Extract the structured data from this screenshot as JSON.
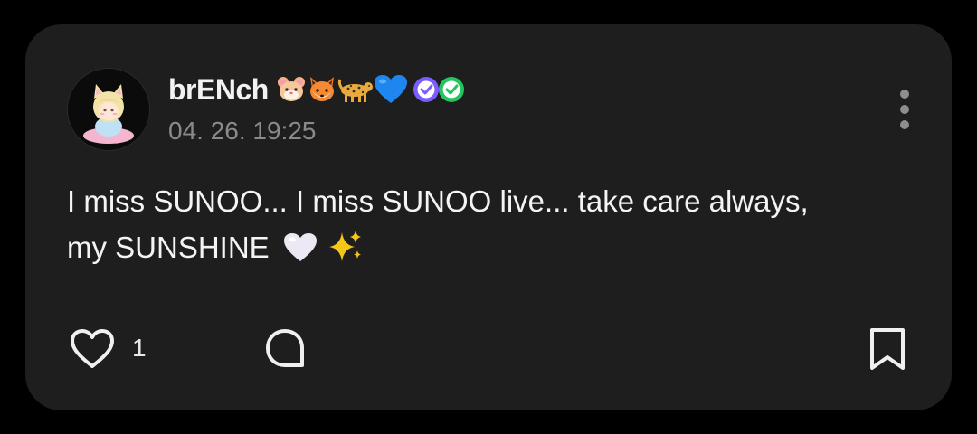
{
  "post": {
    "username": "brENch",
    "name_emojis": [
      "hamster-face-icon",
      "fox-face-icon",
      "leopard-icon",
      "blue-heart-icon"
    ],
    "badges": [
      "purple-verified-check-icon",
      "green-verified-check-icon"
    ],
    "timestamp": "04. 26. 19:25",
    "text_line_1": "I miss SUNOO... I miss SUNOO live... take care always,",
    "text_line_2": "my SUNSHINE",
    "text_emojis": [
      "white-heart-icon",
      "sparkles-icon"
    ],
    "like_count": "1"
  },
  "actions": [
    "heart-icon",
    "comment-icon",
    "bookmark-icon"
  ],
  "colors": {
    "background": "#000000",
    "card": "#1e1e1e",
    "text": "#f4f4f4",
    "muted": "#8a8a8a",
    "badge_purple": "#7b5cff",
    "badge_green": "#22c55e"
  }
}
